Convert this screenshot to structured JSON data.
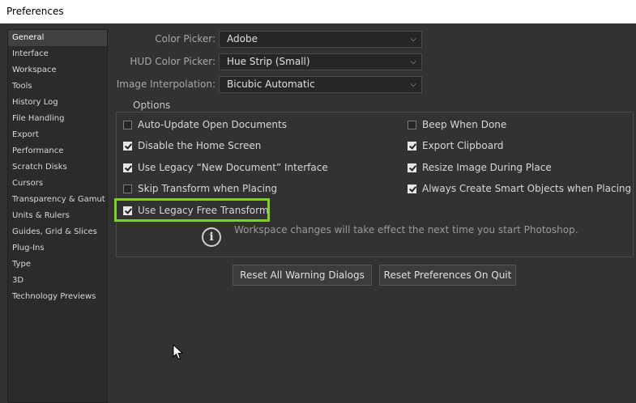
{
  "window": {
    "title": "Preferences"
  },
  "sidebar": {
    "items": [
      {
        "label": "General",
        "active": true
      },
      {
        "label": "Interface"
      },
      {
        "label": "Workspace"
      },
      {
        "label": "Tools"
      },
      {
        "label": "History Log"
      },
      {
        "label": "File Handling"
      },
      {
        "label": "Export"
      },
      {
        "label": "Performance"
      },
      {
        "label": "Scratch Disks"
      },
      {
        "label": "Cursors"
      },
      {
        "label": "Transparency & Gamut"
      },
      {
        "label": "Units & Rulers"
      },
      {
        "label": "Guides, Grid & Slices"
      },
      {
        "label": "Plug-Ins"
      },
      {
        "label": "Type"
      },
      {
        "label": "3D"
      },
      {
        "label": "Technology Previews"
      }
    ]
  },
  "general": {
    "color_picker": {
      "label": "Color Picker:",
      "value": "Adobe"
    },
    "hud_color_picker": {
      "label": "HUD Color Picker:",
      "value": "Hue Strip (Small)"
    },
    "image_interpolation": {
      "label": "Image Interpolation:",
      "value": "Bicubic Automatic"
    }
  },
  "options": {
    "legend": "Options",
    "auto_update": {
      "label": "Auto-Update Open Documents",
      "checked": false
    },
    "beep": {
      "label": "Beep When Done",
      "checked": false
    },
    "disable_home": {
      "label": "Disable the Home Screen",
      "checked": true
    },
    "export_clipboard": {
      "label": "Export Clipboard",
      "checked": true
    },
    "legacy_new_doc": {
      "label": "Use Legacy “New Document” Interface",
      "checked": true
    },
    "resize_image": {
      "label": "Resize Image During Place",
      "checked": true
    },
    "skip_transform": {
      "label": "Skip Transform when Placing",
      "checked": false
    },
    "smart_objects": {
      "label": "Always Create Smart Objects when Placing",
      "checked": true
    },
    "legacy_free_transform": {
      "label": "Use Legacy Free Transform",
      "checked": true
    },
    "info_message": "Workspace changes will take effect the next time you start Photoshop."
  },
  "buttons": {
    "reset_warnings": "Reset All Warning Dialogs",
    "reset_prefs": "Reset Preferences On Quit"
  },
  "icons": {
    "info": "i",
    "chevron": "⌵"
  },
  "colors": {
    "highlight": "#7ed321",
    "background": "#323232"
  }
}
